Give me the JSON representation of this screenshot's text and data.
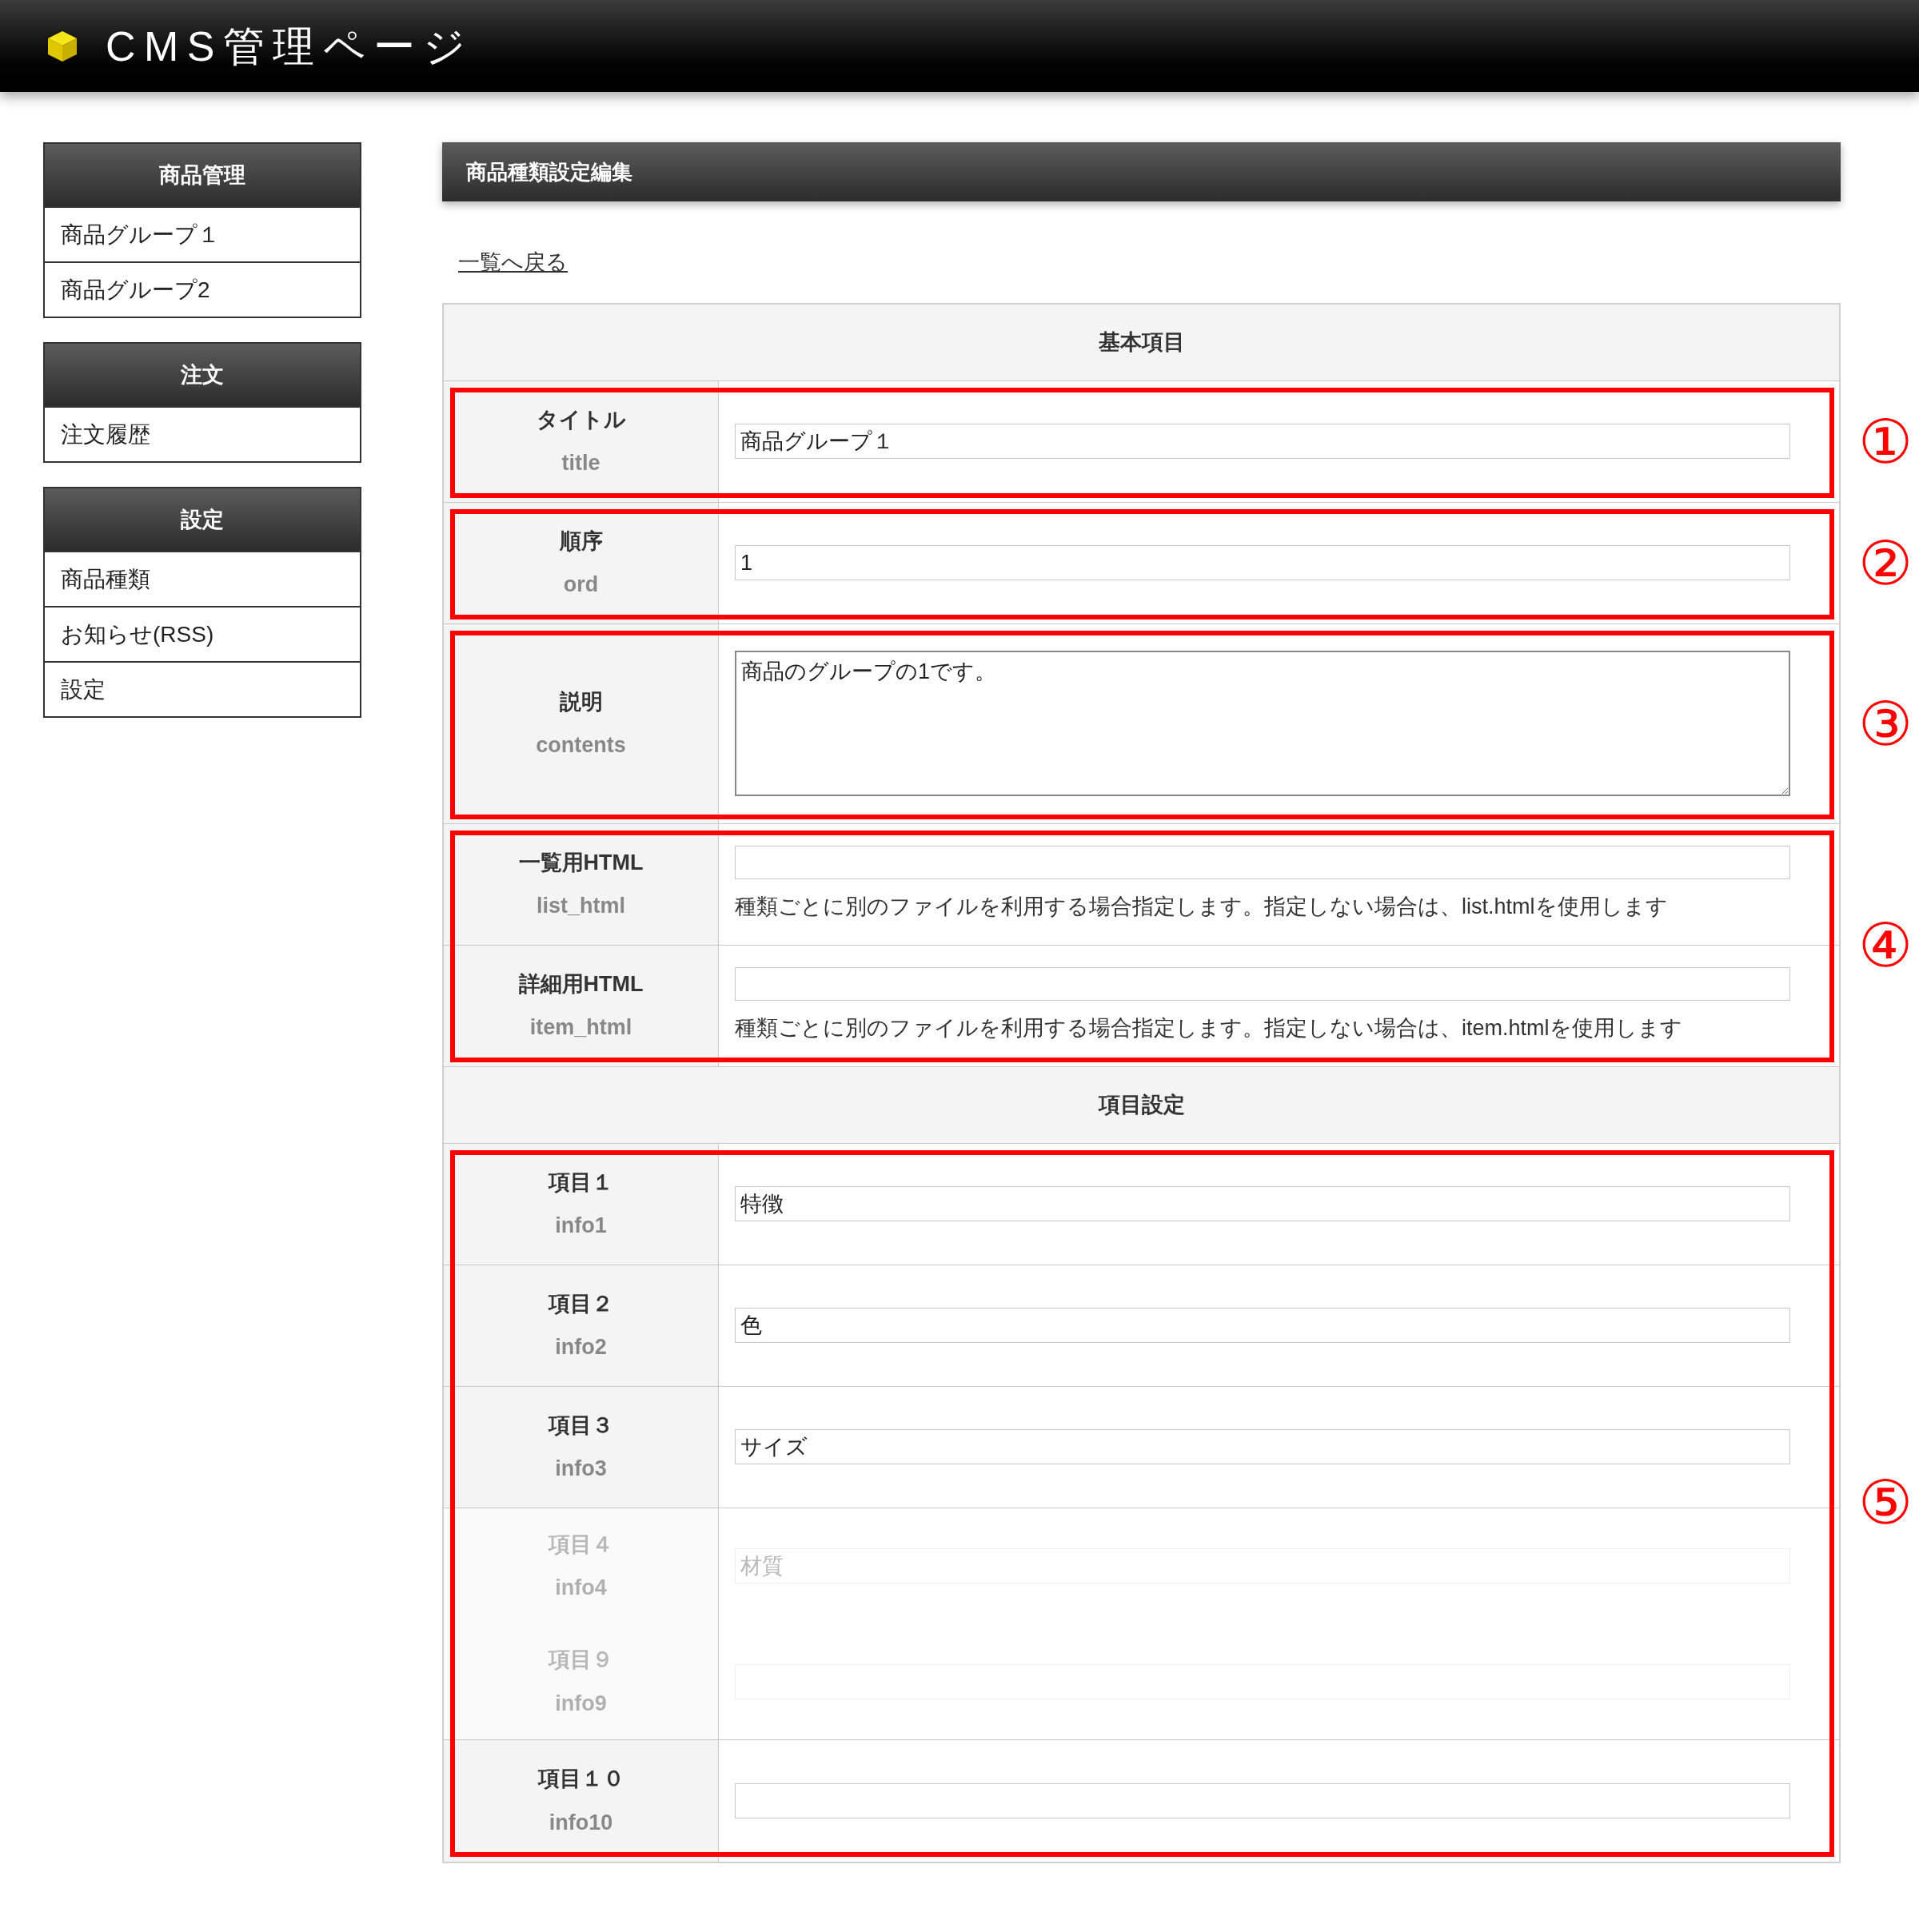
{
  "header": {
    "title": "CMS管理ページ"
  },
  "sidebar": {
    "sections": [
      {
        "title": "商品管理",
        "items": [
          "商品グループ１",
          "商品グループ2"
        ]
      },
      {
        "title": "注文",
        "items": [
          "注文履歴"
        ]
      },
      {
        "title": "設定",
        "items": [
          "商品種類",
          "お知らせ(RSS)",
          "設定"
        ]
      }
    ]
  },
  "main": {
    "title": "商品種類設定編集",
    "back_link": "一覧へ戻る",
    "sections": [
      {
        "heading": "基本項目",
        "groups": [
          {
            "marker": "①",
            "rows": [
              {
                "kind": "text",
                "label": "タイトル",
                "key": "title",
                "value": "商品グループ１",
                "faded": false
              }
            ]
          },
          {
            "marker": "②",
            "rows": [
              {
                "kind": "text",
                "label": "順序",
                "key": "ord",
                "value": "1",
                "faded": false
              }
            ]
          },
          {
            "marker": "③",
            "rows": [
              {
                "kind": "textarea",
                "label": "説明",
                "key": "contents",
                "value": "商品のグループの1です。",
                "faded": false
              }
            ]
          },
          {
            "marker": "④",
            "rows": [
              {
                "kind": "file",
                "label": "一覧用HTML",
                "key": "list_html",
                "hint": "種類ごとに別のファイルを利用する場合指定します。指定しない場合は、list.htmlを使用します",
                "faded": false
              },
              {
                "kind": "file",
                "label": "詳細用HTML",
                "key": "item_html",
                "hint": "種類ごとに別のファイルを利用する場合指定します。指定しない場合は、item.htmlを使用します",
                "faded": false
              }
            ]
          }
        ]
      },
      {
        "heading": "項目設定",
        "groups": [
          {
            "marker": "⑤",
            "rows": [
              {
                "kind": "text",
                "label": "項目１",
                "key": "info1",
                "value": "特徴",
                "faded": false
              },
              {
                "kind": "text",
                "label": "項目２",
                "key": "info2",
                "value": "色",
                "faded": false
              },
              {
                "kind": "text",
                "label": "項目３",
                "key": "info3",
                "value": "サイズ",
                "faded": false
              },
              {
                "kind": "text",
                "label": "項目４",
                "key": "info4",
                "value": "材質",
                "faded": true
              },
              {
                "kind": "text",
                "label": "項目９",
                "key": "info9",
                "faded": true
              },
              {
                "kind": "text",
                "label": "項目１０",
                "key": "info10",
                "faded": false
              }
            ]
          }
        ]
      }
    ]
  }
}
